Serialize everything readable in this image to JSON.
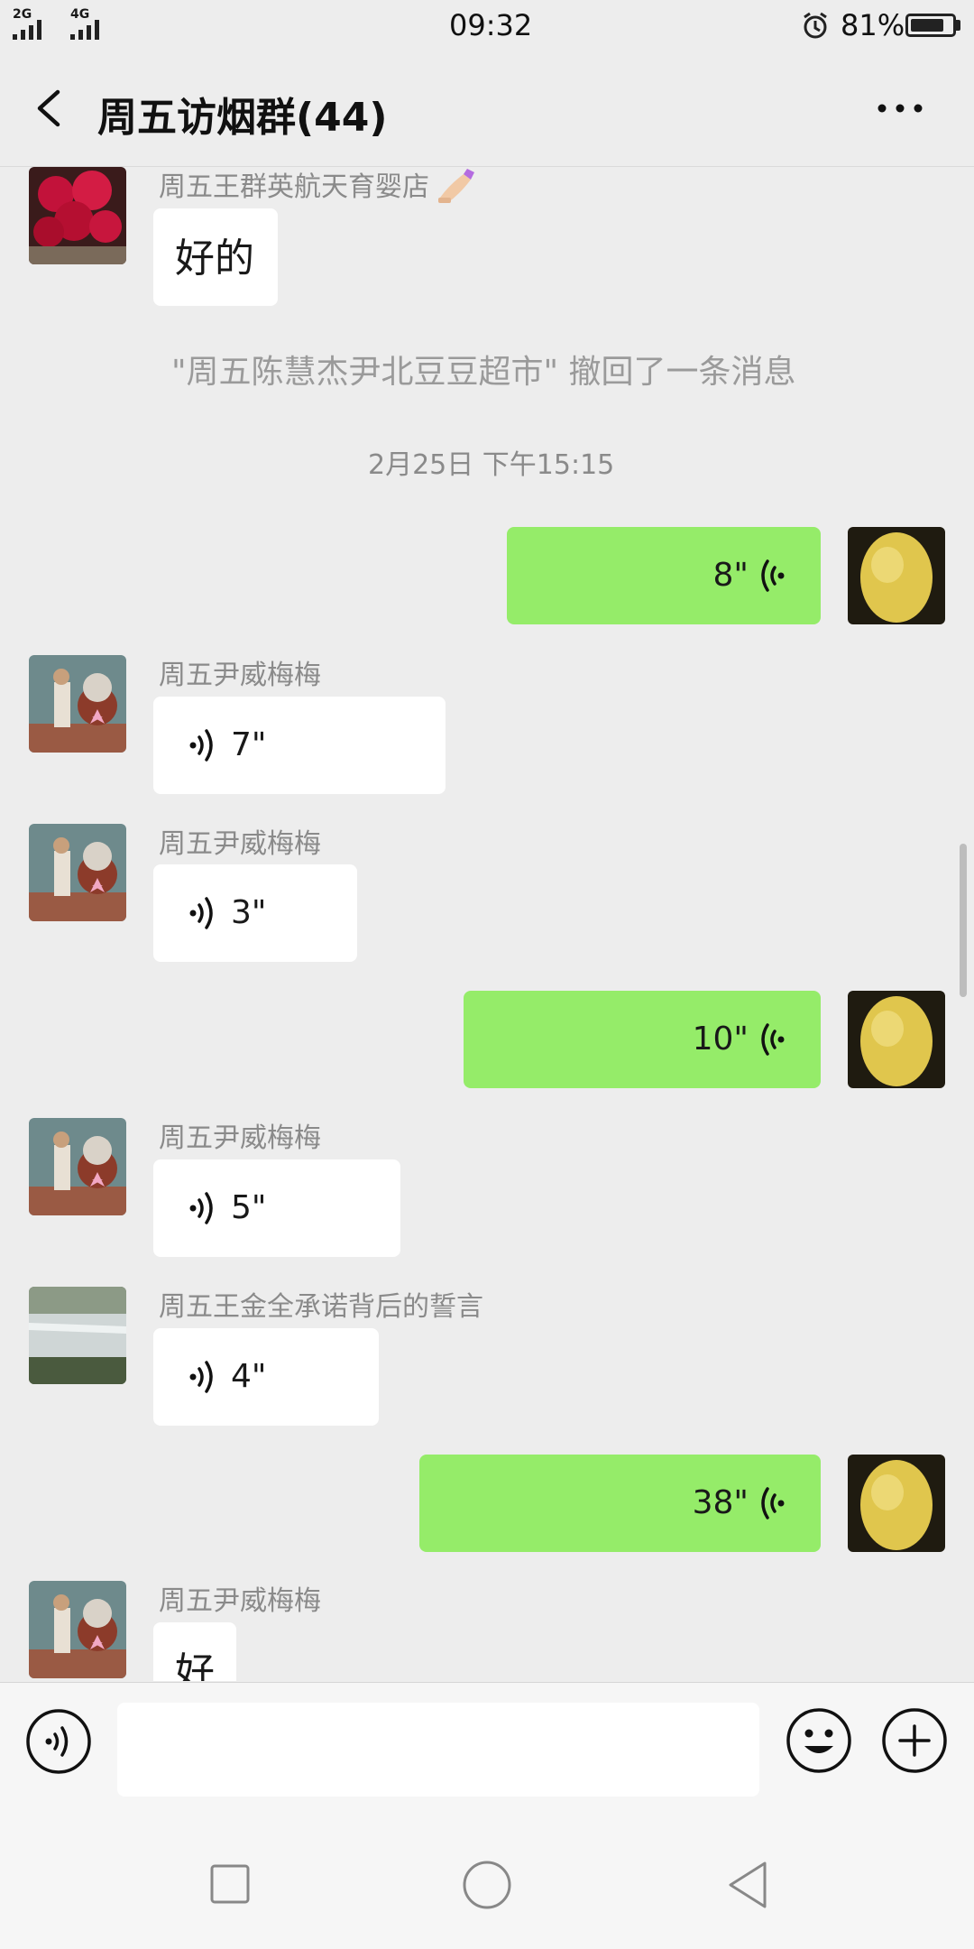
{
  "status_bar": {
    "net_left": "2G",
    "net_right": "4G",
    "time": "09:32",
    "battery": "81%",
    "battery_level": 0.81
  },
  "header": {
    "title": "周五访烟群(44)"
  },
  "messages": {
    "m1": {
      "sender": "周五王群英航天育婴店",
      "text": "好的"
    },
    "recall": "\"周五陈慧杰尹北豆豆超市\" 撤回了一条消息",
    "timestamp": "2月25日 下午15:15",
    "m2": {
      "duration": "8\""
    },
    "m3": {
      "sender": "周五尹威梅梅",
      "duration": "7\""
    },
    "m4": {
      "sender": "周五尹威梅梅",
      "duration": "3\""
    },
    "m5": {
      "duration": "10\""
    },
    "m6": {
      "sender": "周五尹威梅梅",
      "duration": "5\""
    },
    "m7": {
      "sender": "周五王金全承诺背后的誓言",
      "duration": "4\""
    },
    "m8": {
      "duration": "38\""
    },
    "m9": {
      "sender": "周五尹威梅梅",
      "text": "好"
    }
  },
  "input_bar": {
    "value": ""
  },
  "colors": {
    "background": "#ededed",
    "outgoing_bubble": "#95ec69",
    "incoming_bubble": "#ffffff"
  }
}
